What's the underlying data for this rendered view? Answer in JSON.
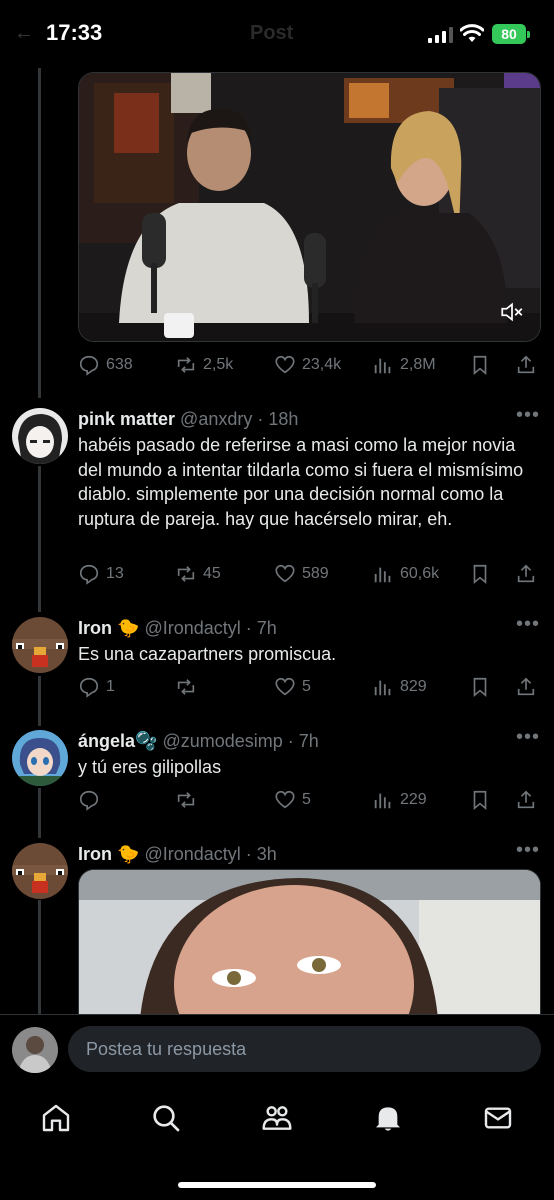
{
  "status_bar": {
    "time": "17:33",
    "battery": "80"
  },
  "header": {
    "title": "Post"
  },
  "main_post": {
    "stats": {
      "replies": "638",
      "reposts": "2,5k",
      "likes": "23,4k",
      "views": "2,8M"
    }
  },
  "replies": [
    {
      "name": "pink matter",
      "handle": "@anxdry",
      "time": "18h",
      "text": "habéis pasado de referirse a masi como la mejor novia del mundo a intentar tildarla como si fuera el mismísimo diablo. simplemente por una decisión normal como la ruptura de pareja. hay que hacérselo mirar, eh.",
      "stats": {
        "replies": "13",
        "reposts": "45",
        "likes": "589",
        "views": "60,6k"
      }
    },
    {
      "name": "Iron",
      "emoji": "🐤",
      "handle": "@Irondactyl",
      "time": "7h",
      "text": "Es una cazapartners promiscua.",
      "stats": {
        "replies": "1",
        "reposts": "",
        "likes": "5",
        "views": "829"
      }
    },
    {
      "name": "ángela",
      "emoji": "🫧",
      "handle": "@zumodesimp",
      "time": "7h",
      "text": "y tú eres gilipollas",
      "stats": {
        "replies": "",
        "reposts": "",
        "likes": "5",
        "views": "229"
      }
    },
    {
      "name": "Iron",
      "emoji": "🐤",
      "handle": "@Irondactyl",
      "time": "3h"
    }
  ],
  "reply_box": {
    "placeholder": "Postea tu respuesta"
  },
  "nav": {
    "icons": [
      "home-icon",
      "search-icon",
      "communities-icon",
      "notifications-icon",
      "messages-icon"
    ]
  },
  "colors": {
    "accent": "#1d9bf0",
    "muted": "#71767b",
    "text": "#e7e9ea",
    "battery": "#34c759"
  }
}
